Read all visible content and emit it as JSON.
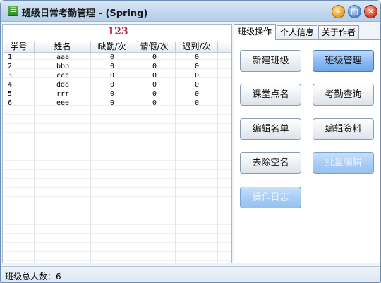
{
  "window": {
    "title": "班级日常考勤管理 - (Spring)",
    "icon": "app-icon"
  },
  "counter": "123",
  "table": {
    "columns": [
      "学号",
      "姓名",
      "缺勤/次",
      "请假/次",
      "迟到/次"
    ],
    "rows": [
      [
        "1",
        "aaa",
        "0",
        "0",
        "0"
      ],
      [
        "2",
        "bbb",
        "0",
        "0",
        "0"
      ],
      [
        "3",
        "ccc",
        "0",
        "0",
        "0"
      ],
      [
        "4",
        "ddd",
        "0",
        "0",
        "0"
      ],
      [
        "5",
        "rrr",
        "0",
        "0",
        "0"
      ],
      [
        "6",
        "eee",
        "0",
        "0",
        "0"
      ]
    ]
  },
  "tabs": [
    {
      "label": "班级操作",
      "active": true
    },
    {
      "label": "个人信息",
      "active": false
    },
    {
      "label": "关于作者",
      "active": false
    }
  ],
  "buttons": {
    "new_class": "新建班级",
    "class_manage": "班级管理",
    "roll_call": "课堂点名",
    "attendance_query": "考勤查询",
    "edit_roster": "编辑名单",
    "edit_info": "编辑资料",
    "remove_empty": "去除空名",
    "batch_edit": "批量编辑",
    "operation_log": "操作日志"
  },
  "status": {
    "total_label": "班级总人数：6"
  },
  "colors": {
    "accent": "#6ea6ea",
    "counter": "#c8102e",
    "border": "#8fa3bd"
  }
}
